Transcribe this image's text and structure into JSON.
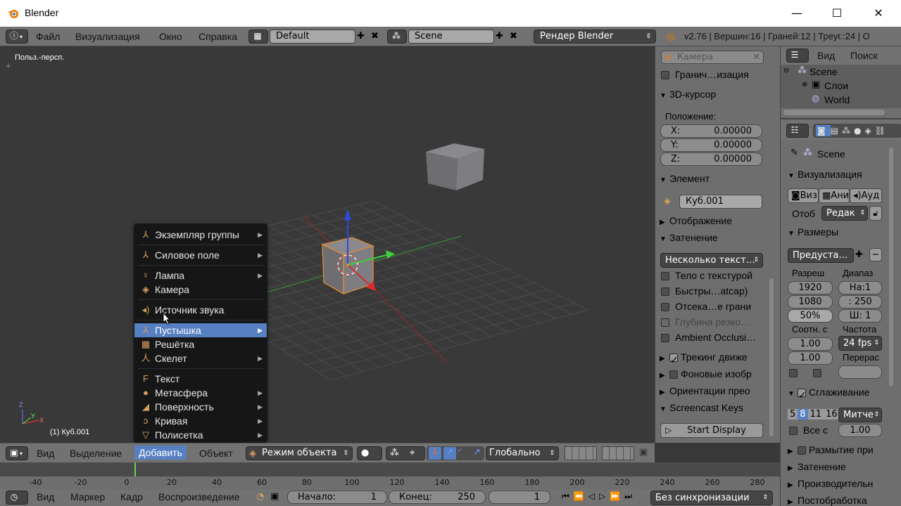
{
  "window": {
    "title": "Blender",
    "minimize": "—",
    "maximize": "☐",
    "close": "✕"
  },
  "info_header": {
    "menus": [
      "Файл",
      "Визуализация",
      "Окно",
      "Справка"
    ],
    "layout_name": "Default",
    "scene_name": "Scene",
    "render_engine": "Рендер Blender",
    "stats": "v2.76 | Вершин:16 | Граней:12 | Треуг.:24 | O"
  },
  "viewport": {
    "view_label": "Польз.-персп.",
    "object_label": "(1) Куб.001",
    "axis_x": "X",
    "axis_y": "Y",
    "axis_z": "Z"
  },
  "add_menu": {
    "items": [
      {
        "label": "Экземпляр группы",
        "icon": "group-instance-icon",
        "glyph": "⅄",
        "submenu": true
      },
      {
        "label": "Силовое поле",
        "icon": "force-field-icon",
        "glyph": "⅄",
        "submenu": true
      },
      {
        "label": "Лампа",
        "icon": "lamp-icon",
        "glyph": "♀",
        "submenu": true
      },
      {
        "label": "Камера",
        "icon": "camera-icon",
        "glyph": "◈",
        "submenu": false
      },
      {
        "label": "Источник звука",
        "icon": "speaker-icon",
        "glyph": "◂)",
        "submenu": false
      },
      {
        "label": "Пустышка",
        "icon": "empty-icon",
        "glyph": "⅄",
        "submenu": true,
        "selected": true
      },
      {
        "label": "Решётка",
        "icon": "lattice-icon",
        "glyph": "▦",
        "submenu": false
      },
      {
        "label": "Скелет",
        "icon": "armature-icon",
        "glyph": "⼈",
        "submenu": true
      },
      {
        "label": "Текст",
        "icon": "text-icon",
        "glyph": "F",
        "submenu": false
      },
      {
        "label": "Метасфера",
        "icon": "metaball-icon",
        "glyph": "●",
        "submenu": true
      },
      {
        "label": "Поверхность",
        "icon": "surface-icon",
        "glyph": "◢",
        "submenu": true
      },
      {
        "label": "Кривая",
        "icon": "curve-icon",
        "glyph": "ɔ",
        "submenu": true
      },
      {
        "label": "Полисетка",
        "icon": "mesh-icon",
        "glyph": "▽",
        "submenu": true
      }
    ]
  },
  "view3d_header": {
    "menus": [
      "Вид",
      "Выделение",
      "Добавить",
      "Объект"
    ],
    "active_menu": "Добавить",
    "mode": "Режим объекта",
    "orientation": "Глобально"
  },
  "timeline": {
    "ticks": [
      "-40",
      "-20",
      "0",
      "20",
      "40",
      "60",
      "80",
      "100",
      "120",
      "140",
      "160",
      "180",
      "200",
      "220",
      "240",
      "260",
      "280"
    ],
    "menus": [
      "Вид",
      "Маркер",
      "Кадр",
      "Воспроизведение"
    ],
    "start_label": "Начало:",
    "start_value": "1",
    "end_label": "Конец:",
    "end_value": "250",
    "current_frame": "1",
    "sync": "Без синхронизации"
  },
  "npanel": {
    "camera_field": "Камера",
    "bounds_label": "Гранич…изация",
    "cursor_header": "3D-курсор",
    "position_label": "Положение:",
    "cursor": [
      {
        "axis": "X:",
        "value": "0.00000"
      },
      {
        "axis": "Y:",
        "value": "0.00000"
      },
      {
        "axis": "Z:",
        "value": "0.00000"
      }
    ],
    "item_header": "Элемент",
    "item_name": "Куб.001",
    "display_header": "Отображение",
    "shading_header": "Затенение",
    "material_mode": "Несколько текст…",
    "shading_opts": [
      "Тело с текстурой",
      "Быстры…atcap)",
      "Отсека…е грани",
      "Глубина резко…",
      "Ambient Occlusi…"
    ],
    "motion_tracking": "Трекинг движе",
    "background_images": "Фоновые изобр",
    "transform_orient": "Ориентации прео",
    "screencast": "Screencast Keys",
    "start_display": "Start Display"
  },
  "outliner": {
    "view": "Вид",
    "search": "Поиск",
    "scene": "Scene",
    "layers": "Слои",
    "world": "World"
  },
  "properties": {
    "scene": "Scene",
    "render_header": "Визуализация",
    "render_btns": [
      "Виз",
      "Ани",
      "Ауд"
    ],
    "display_label": "Отоб",
    "display_value": "Редак",
    "dimensions_header": "Размеры",
    "presets": "Предуста…",
    "res_label": "Разреш",
    "range_label": "Диапаз",
    "res_x": "1920",
    "res_y": "1080",
    "res_pct": "50%",
    "frame_start": "На:1",
    "frame_end": ": 250",
    "frame_step": "Ш: 1",
    "aspect_label": "Соотн. с",
    "fps_label": "Частота",
    "aspect_x": "1.00",
    "aspect_y": "1.00",
    "fps": "24 fps",
    "remap_label": "Перерас",
    "aa_header": "Сглаживание",
    "aa_samples": [
      "5",
      "8",
      "11",
      "16"
    ],
    "aa_filter": "Митче",
    "full_sample": "Все с",
    "filter_size": "1.00",
    "motion_blur": "Размытие при",
    "shading": "Затенение",
    "performance": "Производительн",
    "post_processing": "Постобработка"
  }
}
